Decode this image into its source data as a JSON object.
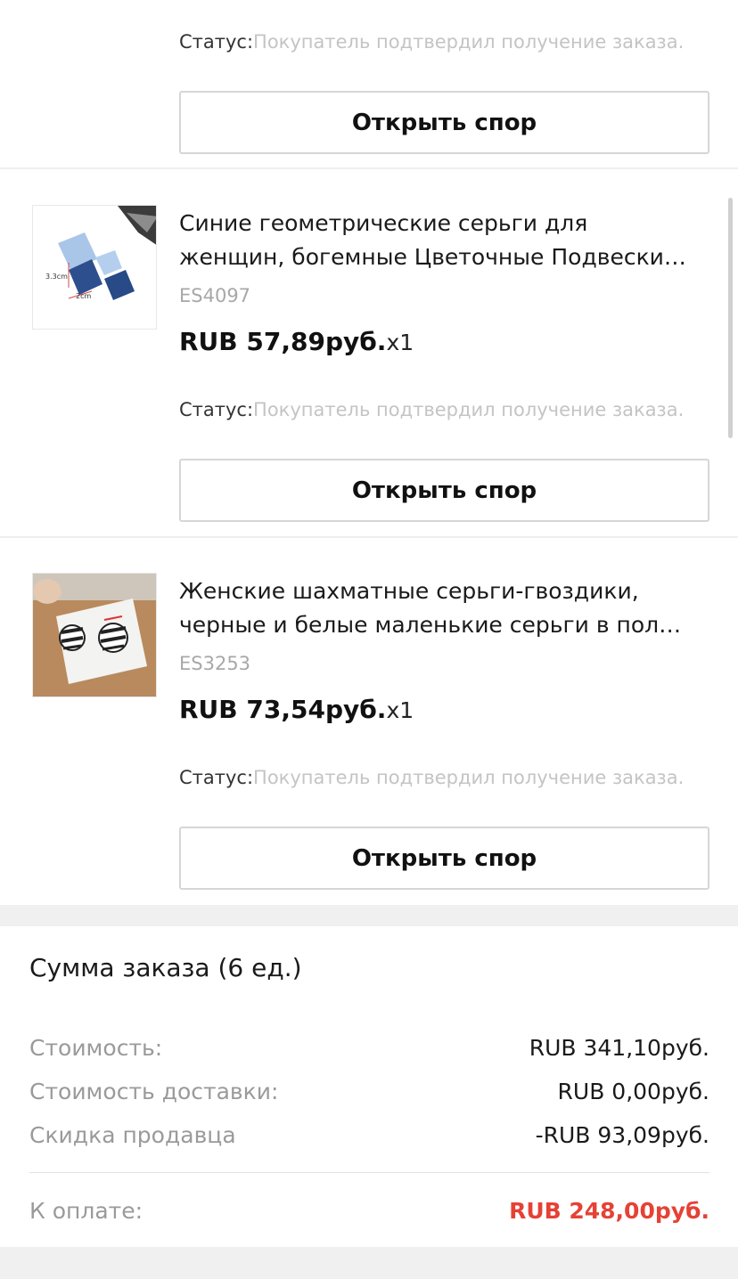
{
  "top_item": {
    "status_label": "Статус:",
    "status_value": "Покупатель подтвердил получение заказа.",
    "dispute_label": "Открыть спор"
  },
  "items": [
    {
      "title_line1": "Синие геометрические серьги для",
      "title_line2": "женщин, богемные Цветочные Подвески…",
      "sku": "ES4097",
      "price": "RUB 57,89руб.",
      "qty": "x1",
      "status_label": "Статус:",
      "status_value": "Покупатель подтвердил получение заказа.",
      "dispute_label": "Открыть спор",
      "image_labels": [
        "3.3cm",
        "2cm"
      ]
    },
    {
      "title_line1": "Женские шахматные серьги-гвоздики,",
      "title_line2": "черные и белые маленькие серьги в пол…",
      "sku": "ES3253",
      "price": "RUB 73,54руб.",
      "qty": "x1",
      "status_label": "Статус:",
      "status_value": "Покупатель подтвердил получение заказа.",
      "dispute_label": "Открыть спор"
    }
  ],
  "summary": {
    "title": "Сумма заказа (6 ед.)",
    "rows": [
      {
        "label": "Стоимость:",
        "value": "RUB 341,10руб."
      },
      {
        "label": "Стоимость доставки:",
        "value": "RUB 0,00руб."
      },
      {
        "label": "Скидка продавца",
        "value": "-RUB 93,09руб."
      }
    ],
    "total_label": "К оплате:",
    "total_value": "RUB 248,00руб."
  },
  "colors": {
    "accent_total": "#e54235",
    "status_value": "#c4c4c4"
  }
}
